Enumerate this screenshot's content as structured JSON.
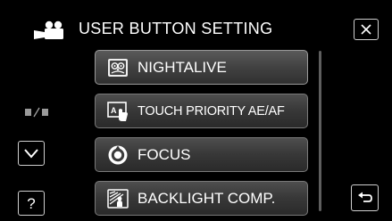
{
  "header": {
    "title": "USER BUTTON SETTING",
    "title_icon": "movie-camera-icon",
    "close_icon": "close-x-icon"
  },
  "menu": {
    "items": [
      {
        "label": "NIGHTALIVE",
        "icon": "owl-night-icon",
        "selected": true
      },
      {
        "label": "TOUCH PRIORITY AE/AF",
        "icon": "touch-priority-icon",
        "selected": false
      },
      {
        "label": "FOCUS",
        "icon": "focus-icon",
        "selected": false
      },
      {
        "label": "BACKLIGHT COMP.",
        "icon": "backlight-icon",
        "selected": false
      }
    ]
  },
  "controls": {
    "page_indicator_icon": "page-indicator-icon",
    "down_icon": "chevron-down-icon",
    "help_label": "?",
    "back_icon": "return-icon"
  },
  "colors": {
    "background": "#000000",
    "item_fill": "#3a3a3a",
    "item_border": "#7a7a7a",
    "text": "#ffffff"
  }
}
